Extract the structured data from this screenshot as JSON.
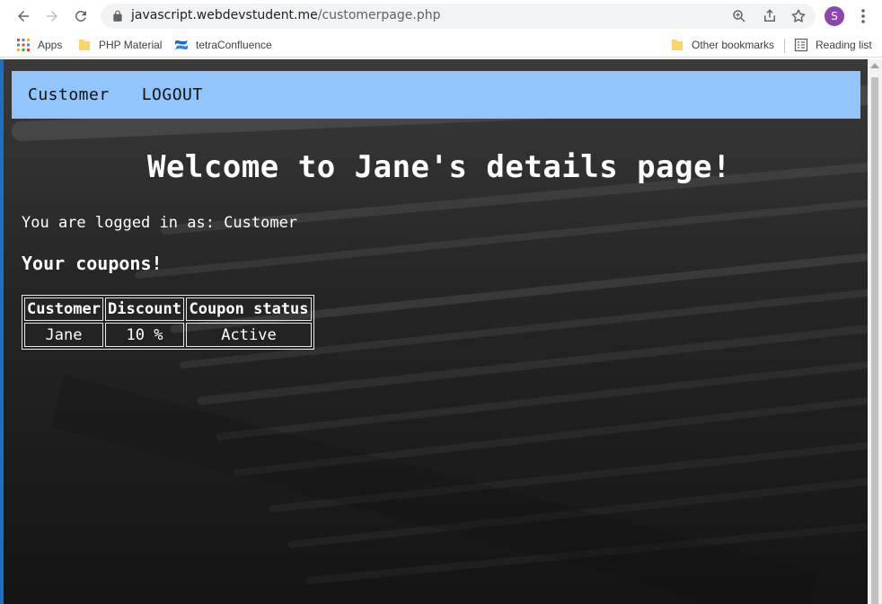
{
  "browser": {
    "url_host": "javascript.webdevstudent.me",
    "url_path": "/customerpage.php",
    "profile_initial": "S",
    "bookmarks": [
      {
        "label": "Apps",
        "icon": "apps-grid-icon"
      },
      {
        "label": "PHP Material",
        "icon": "folder-icon"
      },
      {
        "label": "tetraConfluence",
        "icon": "confluence-icon"
      }
    ],
    "other_bookmarks": "Other bookmarks",
    "reading_list": "Reading list"
  },
  "nav": {
    "customer_link": "Customer",
    "logout_link": "LOGOUT",
    "bar_color": "#93c5fd"
  },
  "page": {
    "heading": "Welcome to Jane's details page!",
    "logged_in_text": "You are logged in as: Customer",
    "coupons_heading": "Your coupons!"
  },
  "coupons_table": {
    "headers": [
      "Customer",
      "Discount",
      "Coupon status"
    ],
    "rows": [
      [
        "Jane",
        "10 %",
        "Active"
      ]
    ]
  }
}
